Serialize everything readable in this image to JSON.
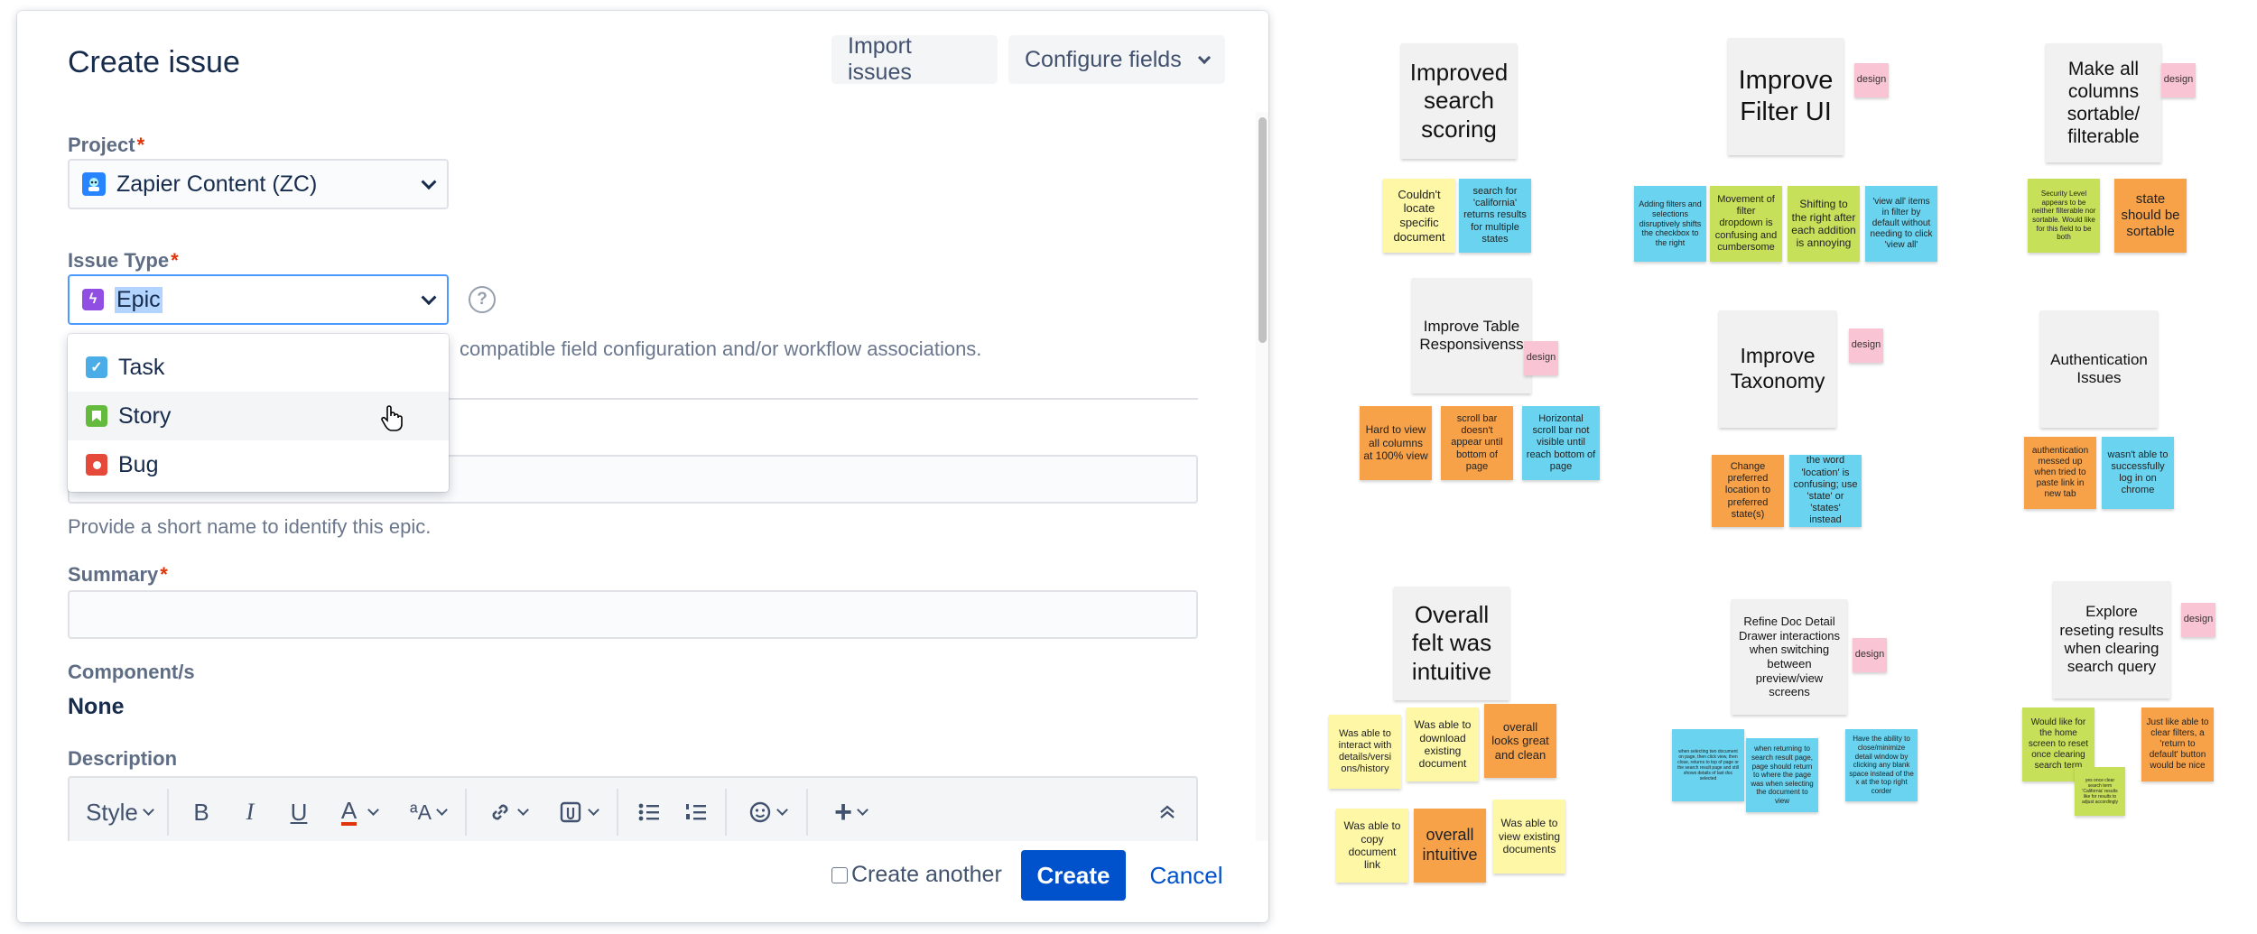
{
  "dialog": {
    "title": "Create issue",
    "import_label": "Import issues",
    "configure_label": "Configure fields",
    "project": {
      "label": "Project",
      "value": "Zapier Content (ZC)"
    },
    "issue_type": {
      "label": "Issue Type",
      "value": "Epic",
      "help": "?",
      "info": "compatible field configuration and/or workflow associations."
    },
    "dropdown": [
      {
        "label": "Task",
        "color": "#4bade8"
      },
      {
        "label": "Story",
        "color": "#63ba3c"
      },
      {
        "label": "Bug",
        "color": "#e5493a"
      }
    ],
    "epic_name_helper": "Provide a short name to identify this epic.",
    "summary_label": "Summary",
    "components_label": "Component/s",
    "components_value": "None",
    "description_label": "Description",
    "toolbar": {
      "style": "Style",
      "bold": "B",
      "italic": "I",
      "underline": "U",
      "color": "A",
      "more": "ªA"
    },
    "create_another": "Create another",
    "create": "Create",
    "cancel": "Cancel"
  },
  "board": {
    "headers": [
      "Improved search scoring",
      "Improve Filter UI",
      "Make all columns sortable/ filterable",
      "Improve Table Responsivenss",
      "Improve Taxonomy",
      "Authentication Issues",
      "Overall felt was intuitive",
      "Refine Doc Detail Drawer interactions when switching between preview/view screens",
      "Explore reseting results when clearing search query"
    ],
    "tag": "design",
    "notes": [
      "Couldn't locate specific document",
      "search for 'california' returns results for multiple states",
      "Adding filters and selections disruptively shifts the checkbox to the right",
      "Movement of filter dropdown is confusing and cumbersome",
      "Shifting to the right after each addition is annoying",
      "'view all' items in filter by default without needing to click 'view all'",
      "Security Level appears to be neither filterable nor sortable. Would like for this field to be both",
      "state should be sortable",
      "Hard to view all columns at 100% view",
      "scroll bar doesn't appear until bottom of page",
      "Horizontal scroll bar not visible until reach bottom of page",
      "Change preferred location to preferred state(s)",
      "the word 'location' is confusing; use 'state' or 'states' instead",
      "authentication messed up when tried to paste link in new tab",
      "wasn't able to successfully log in on chrome",
      "Was able to interact with details/versi ons/history",
      "Was able to download existing document",
      "overall looks great and clean",
      "Was able to copy document link",
      "overall intuitive",
      "Was able to view existing documents",
      "when selecting two document on page, then click view, then close, returns to top of page or the search result page and still shows details of last doc selected",
      "when returning to search result page, page should return to where the page was when selecting the document to view",
      "Have the ability to close/minimize detail window by clicking any blank space instead of the x at the top right corder",
      "Would like for the home screen to reset once clearing search term",
      "yes once clear search term 'California' results like for results to adjust accordingly",
      "Just like able to clear filters, a 'return to default' button would be nice"
    ]
  }
}
